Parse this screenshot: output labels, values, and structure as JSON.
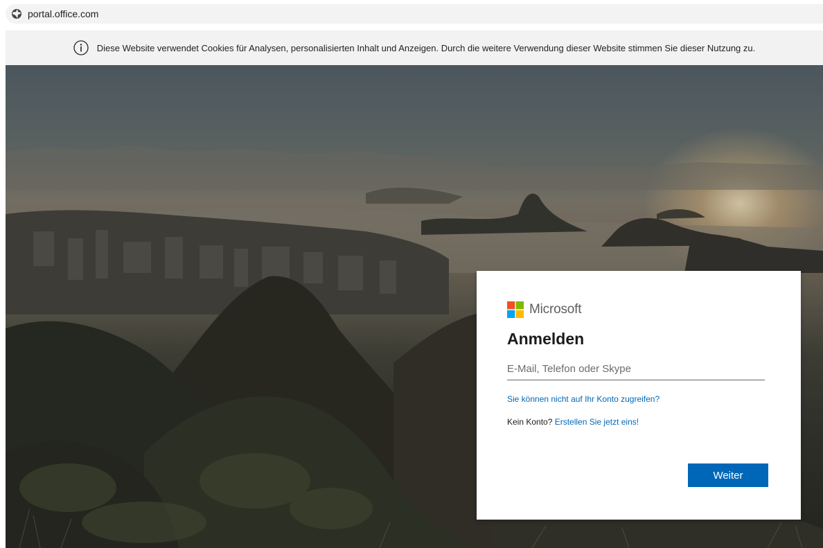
{
  "browser": {
    "url": "portal.office.com",
    "url_icon": "globe-icon"
  },
  "cookie_banner": {
    "icon": "info-icon",
    "text": "Diese Website verwendet Cookies für Analysen, personalisierten Inhalt und Anzeigen. Durch die weitere Verwendung dieser Website stimmen Sie dieser Nutzung zu."
  },
  "signin": {
    "brand_name": "Microsoft",
    "logo_colors": [
      "#f25022",
      "#7fba00",
      "#00a4ef",
      "#ffb900"
    ],
    "title": "Anmelden",
    "email_placeholder": "E-Mail, Telefon oder Skype",
    "email_value": "",
    "forgot_link": "Sie können nicht auf Ihr Konto zugreifen?",
    "no_account_text": "Kein Konto?",
    "create_link": "Erstellen Sie jetzt eins!",
    "next_label": "Weiter",
    "accent_color": "#0067b8"
  }
}
